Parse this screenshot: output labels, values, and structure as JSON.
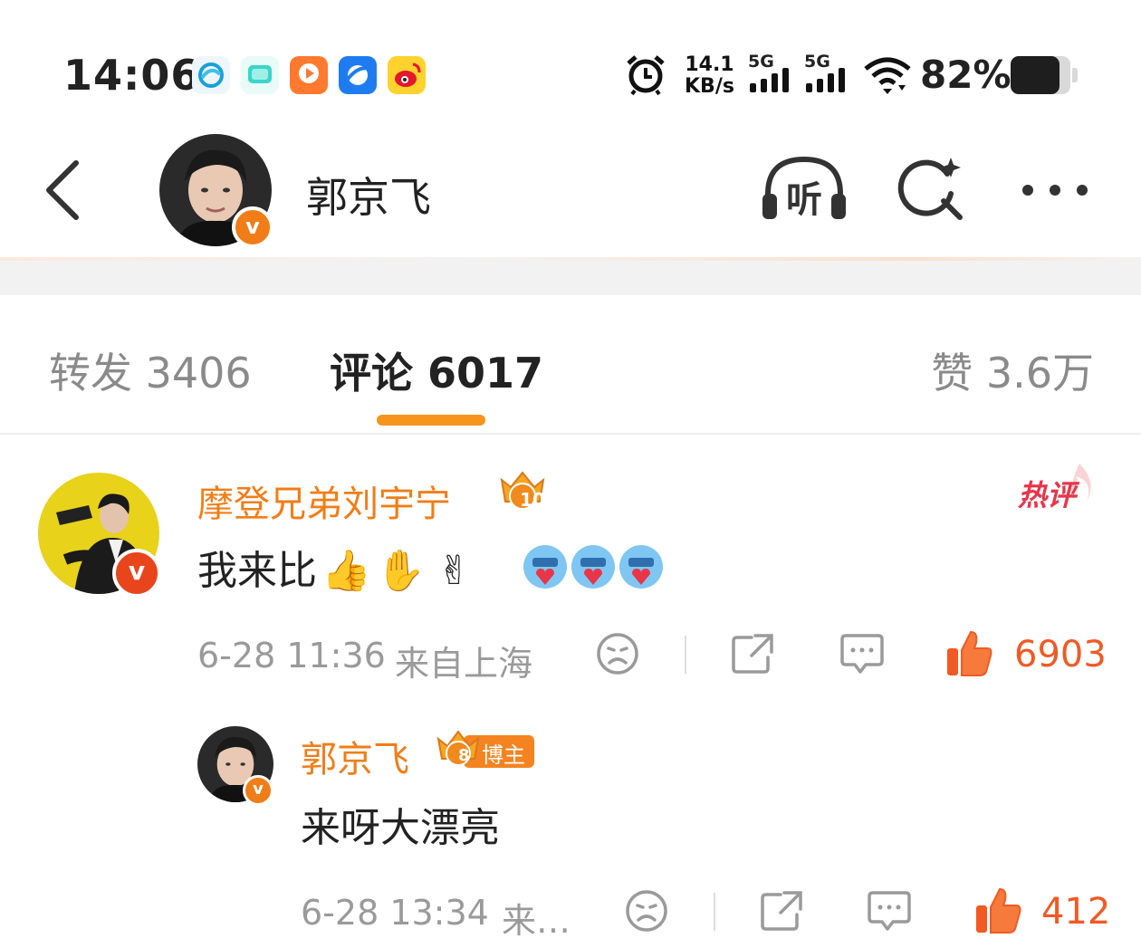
{
  "status_bar": {
    "time": "14:06",
    "net_speed_value": "14.1",
    "net_speed_unit": "KB/s",
    "signal_1_label": "5G",
    "signal_2_label": "5G",
    "battery_percent": "82%",
    "battery_level": 0.82,
    "app_icons": [
      "china-mobile-icon",
      "chat-app-icon",
      "video-app-icon",
      "browser-app-icon",
      "weibo-app-icon"
    ]
  },
  "header": {
    "title": "郭京飞",
    "listen_label": "听",
    "verified_mark": "v"
  },
  "tabs": {
    "repost": "转发 3406",
    "comments": "评论 6017",
    "likes": "赞 3.6万"
  },
  "comment": {
    "username": "摩登兄弟刘宇宁",
    "level_badge": "10",
    "hot_tag": "热评",
    "text": "我来比",
    "emojis": [
      "👍",
      "✋",
      "✌"
    ],
    "timestamp": "6-28 11:36",
    "location": "来自上海",
    "like_count": "6903"
  },
  "reply": {
    "username": "郭京飞",
    "level_badge": "8",
    "author_tag": "博主",
    "text": "来呀大漂亮",
    "timestamp": "6-28 13:34",
    "location": "来…",
    "like_count": "412"
  },
  "colors": {
    "accent_orange": "#f07d17",
    "like_red": "#f05a24",
    "tab_indicator": "#f7941d",
    "hot_tag": "#e8354a"
  }
}
